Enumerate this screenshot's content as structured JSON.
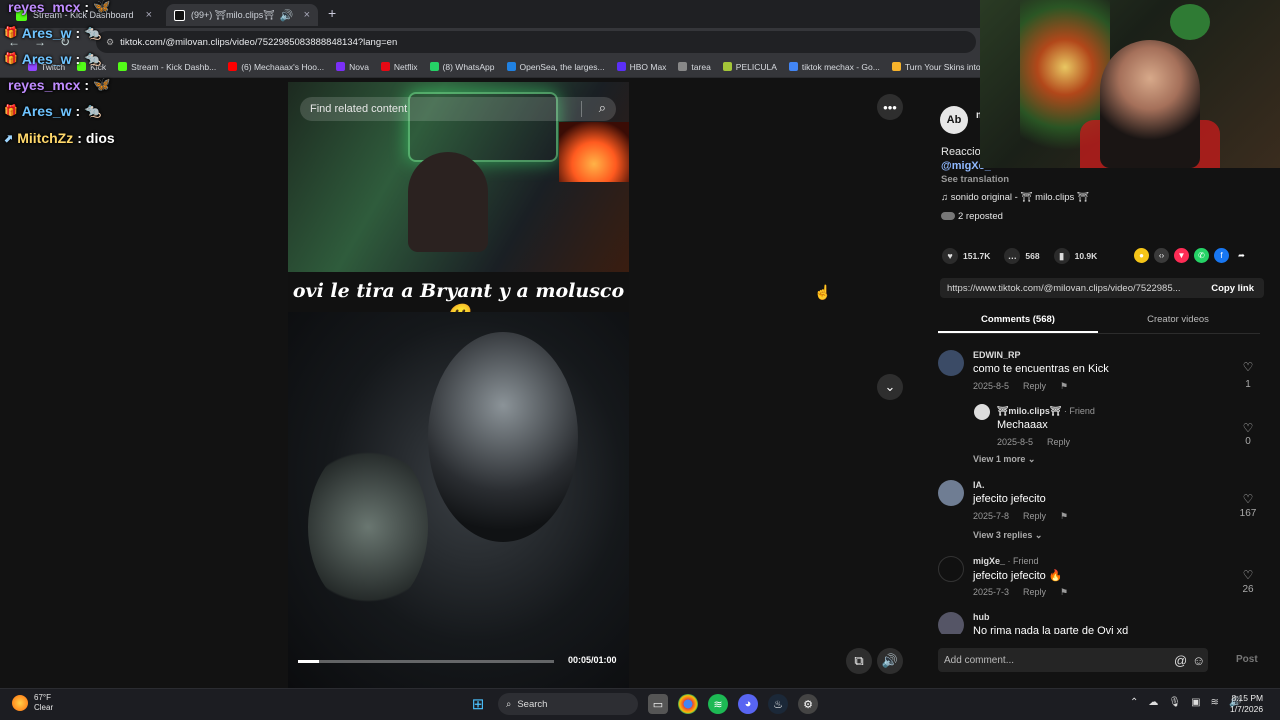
{
  "browser": {
    "tabs": [
      {
        "label": "Stream - Kick Dashboard",
        "active": false
      },
      {
        "label": "(99+) ⛩milo.clips⛩ (@m",
        "active": true
      }
    ],
    "url": "tiktok.com/@milovan.clips/video/7522985083888848134?lang=en",
    "bookmarks": [
      "Twitch",
      "Kick",
      "Stream - Kick Dashb...",
      "(6) Mechaaax's Hoo...",
      "Nova",
      "Netflix",
      "(8) WhatsApp",
      "OpenSea, the larges...",
      "HBO Max",
      "tarea",
      "PELICULA",
      "tiktok mechax - Go...",
      "Turn Your Skins into..."
    ]
  },
  "chat": [
    {
      "user": "reyes_mcx",
      "msg": "🦋",
      "color": "#c08cff"
    },
    {
      "user": "Ares_w",
      "msg": "🐀",
      "color": "#6fc4ff"
    },
    {
      "user": "Ares_w",
      "msg": "🐀",
      "color": "#6fc4ff"
    },
    {
      "user": "reyes_mcx",
      "msg": "🦋",
      "color": "#c08cff"
    },
    {
      "user": "Ares_w",
      "msg": "🐀",
      "color": "#6fc4ff"
    },
    {
      "user": "MiitchZz",
      "msg": "dios",
      "color": "#ffd86b"
    }
  ],
  "video": {
    "search_placeholder": "Find related content",
    "caption": "ovi le tira a Bryant y a molusco😮",
    "time": "00:05/01:00",
    "progress": 0.083
  },
  "panel": {
    "author_initials": "Ab",
    "author_name": "m",
    "desc_line1": "Reaccio",
    "desc_line2": "@migXe_",
    "see_translation": "See translation",
    "sound": "sonido original - ⛩ milo.clips ⛩",
    "reposted": "2 reposted",
    "likes": "151.7K",
    "comments_count": "568",
    "saves": "10.9K",
    "link": "https://www.tiktok.com/@milovan.clips/video/7522985...",
    "copy_link": "Copy link",
    "tab_comments": "Comments (568)",
    "tab_creator": "Creator videos",
    "add_comment": "Add comment...",
    "post": "Post"
  },
  "comments": [
    {
      "user": "EDWIN_RP",
      "text": "como te encuentras en Kick",
      "date": "2025-8-5",
      "reply": "Reply",
      "likes": "1"
    },
    {
      "user": "⛩milo.clips⛩",
      "friend": " · Friend",
      "text": "Mechaaax",
      "date": "2025-8-5",
      "reply": "Reply",
      "likes": "0"
    },
    {
      "more": "View 1 more ⌄"
    },
    {
      "user": "IA.",
      "text": "jefecito jefecito",
      "date": "2025-7-8",
      "reply": "Reply",
      "likes": "167"
    },
    {
      "more": "View 3 replies ⌄"
    },
    {
      "user": "migXe_",
      "friend": " · Friend",
      "text": "jefecito jefecito 🔥",
      "date": "2025-7-3",
      "reply": "Reply",
      "likes": "26"
    },
    {
      "user": "hub",
      "text": "No rima nada la parte de Ovi xd",
      "date": "",
      "reply": "",
      "likes": ""
    }
  ],
  "taskbar": {
    "temp": "67°F",
    "weather": "Clear",
    "search": "Search",
    "time": "8:15 PM",
    "date": "1/7/2026"
  }
}
